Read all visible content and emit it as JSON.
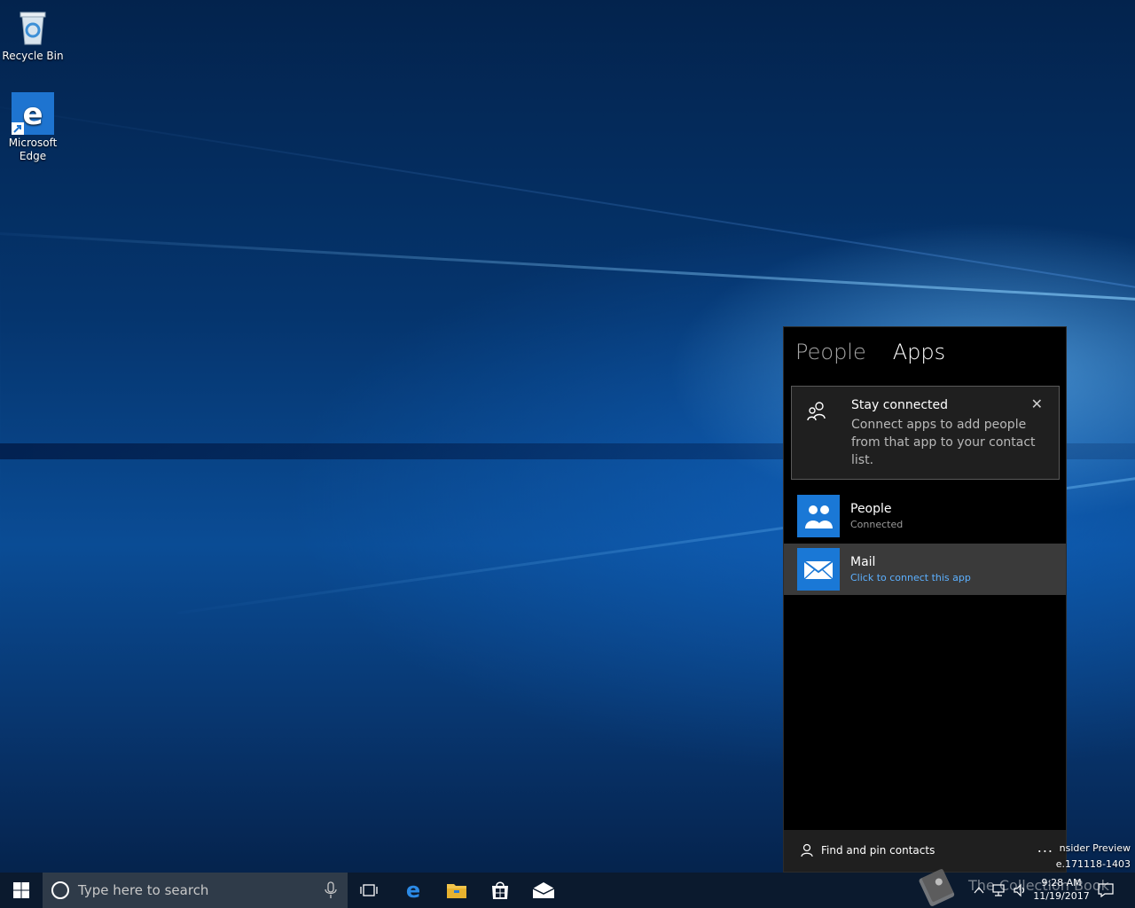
{
  "desktop": {
    "icons": [
      {
        "label": "Recycle Bin"
      },
      {
        "label": "Microsoft Edge"
      }
    ]
  },
  "people_flyout": {
    "tabs": [
      "People",
      "Apps"
    ],
    "active_tab": "Apps",
    "notice": {
      "title": "Stay connected",
      "body": "Connect apps to add people from that app to your contact list.",
      "close_glyph": "✕"
    },
    "apps": [
      {
        "name": "People",
        "status": "Connected"
      },
      {
        "name": "Mail",
        "status": "Click to connect this app"
      }
    ],
    "footer": {
      "label": "Find and pin contacts",
      "more_glyph": "..."
    }
  },
  "watermark": {
    "line1": "nsider Preview",
    "line2": "e.171118-1403"
  },
  "taskbar": {
    "search_placeholder": "Type here to search",
    "clock_time": "9:28 AM",
    "clock_date": "11/19/2017",
    "overlay_text": "The Collection Book"
  },
  "colors": {
    "accent": "#1a78d6",
    "link": "#5cb0ff",
    "taskbar": "#0b1a2e"
  }
}
